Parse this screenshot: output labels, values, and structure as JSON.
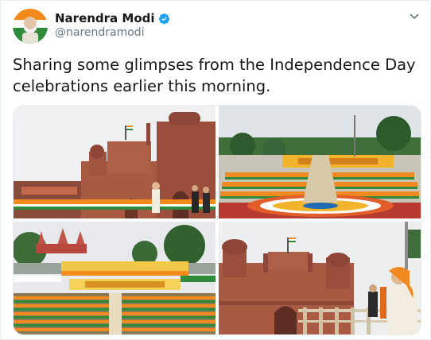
{
  "author": {
    "name": "Narendra Modi",
    "handle": "@narendramodi",
    "verified": true,
    "avatar_icon": "profile-photo",
    "verified_icon": "verified-badge-icon"
  },
  "tweet": {
    "text": "Sharing some glimpses from the Independence Day celebrations earlier this morning."
  },
  "media": {
    "photos": [
      {
        "subject": "red-fort-walk-photo"
      },
      {
        "subject": "flower-formation-photo"
      },
      {
        "subject": "seated-crowd-photo"
      },
      {
        "subject": "red-fort-address-photo"
      }
    ]
  },
  "icons": {
    "menu": "chevron-down-icon"
  },
  "colors": {
    "text": "#14171a",
    "secondary": "#657786",
    "verified_blue": "#1da1f2",
    "fort_red": "#a85a43",
    "saffron": "#f28a1c",
    "india_green": "#2f8a3a"
  }
}
